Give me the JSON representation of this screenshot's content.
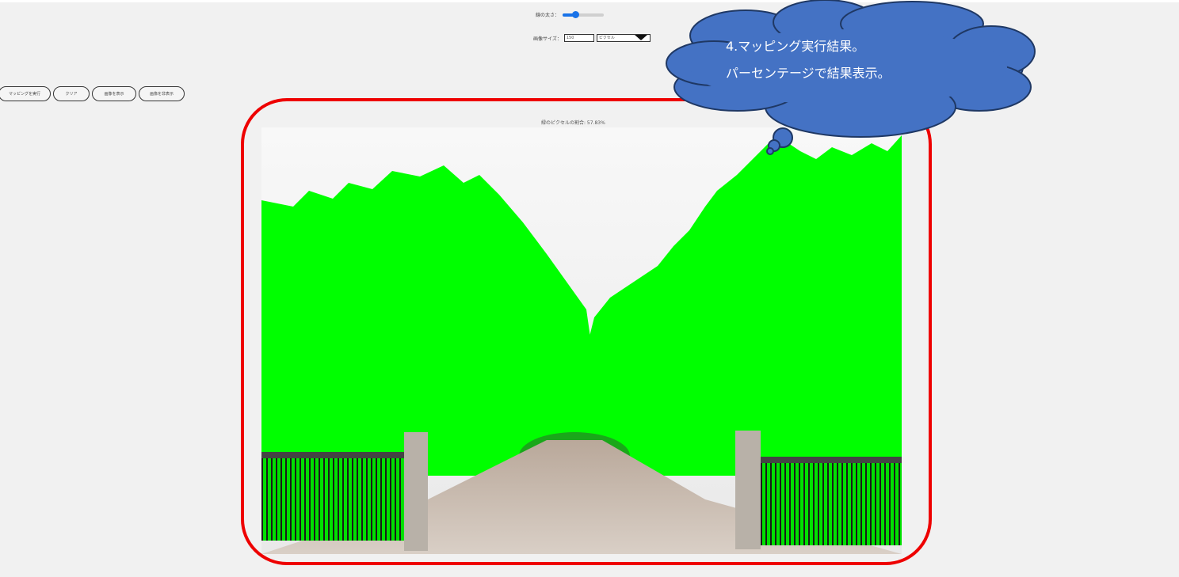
{
  "controls": {
    "thickness_label": "線の太さ：",
    "thickness_level": 0.3,
    "size_label": "画像サイズ：",
    "size_value": "150",
    "unit_selected": "ピクセル"
  },
  "buttons": [
    {
      "label": "マッピングを実行"
    },
    {
      "label": "クリア"
    },
    {
      "label": "画像を表示"
    },
    {
      "label": "画像を非表示"
    }
  ],
  "result": {
    "label": "緑のピクセルの割合: 57.83%"
  },
  "callout": {
    "line1": "4.マッピング実行結果。",
    "line2": "パーセンテージで結果表示。"
  },
  "colors": {
    "frame": "#ee0000",
    "cloud_fill": "#4472c4",
    "mapped_green": "#00ff00",
    "slider_accent": "#1a73e8"
  }
}
